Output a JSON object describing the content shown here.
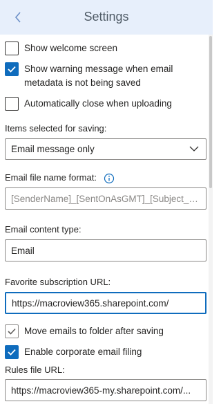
{
  "header": {
    "title": "Settings"
  },
  "checkboxes": {
    "show_welcome": {
      "label": "Show welcome screen",
      "checked": false
    },
    "show_warning": {
      "label_line1": "Show warning message when email",
      "label_line2": "metadata is not being saved",
      "checked": true
    },
    "auto_close": {
      "label": "Automatically close when uploading",
      "checked": false
    },
    "move_emails": {
      "label": "Move emails to folder after saving",
      "checked": true
    },
    "corporate_filing": {
      "label": "Enable corporate email filing",
      "checked": true
    }
  },
  "items_selected": {
    "label": "Items selected for saving:",
    "value": "Email message only"
  },
  "file_name_format": {
    "label": "Email file name format:",
    "value": "[SenderName]_[SentOnAsGMT]_[Subject_F..."
  },
  "content_type": {
    "label": "Email content type:",
    "value": "Email"
  },
  "favorite_url": {
    "label": "Favorite subscription URL:",
    "value": "https://macroview365.sharepoint.com/"
  },
  "rules_url": {
    "label": "Rules file URL:",
    "value": "https://macroview365-my.sharepoint.com/..."
  },
  "colors": {
    "header_bg": "#e7effb",
    "accent": "#0f6cbd"
  }
}
